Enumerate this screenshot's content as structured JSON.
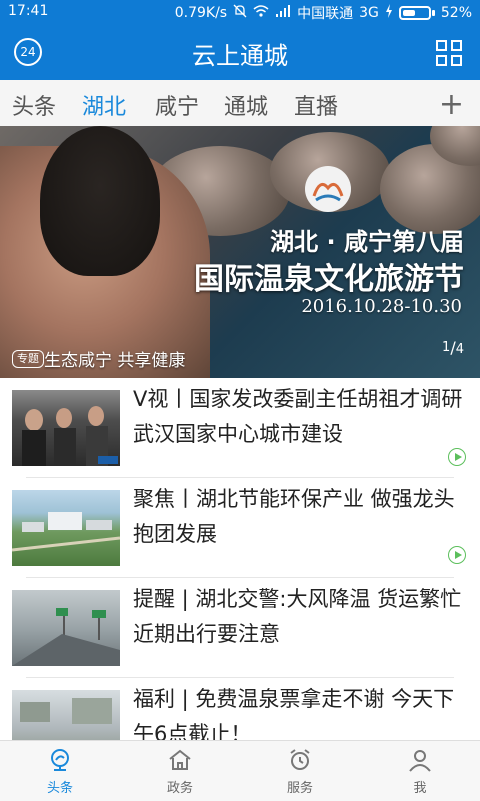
{
  "status_bar": {
    "time": "17:41",
    "speed": "0.79K/s",
    "carrier": "中国联通",
    "network": "3G",
    "battery_percent": "52%",
    "battery_level": 0.52
  },
  "header": {
    "title": "云上通城",
    "badge_24": "24"
  },
  "tabs": [
    {
      "label": "头条",
      "active": false
    },
    {
      "label": "湖北",
      "active": true
    },
    {
      "label": "咸宁",
      "active": false
    },
    {
      "label": "通城",
      "active": false
    },
    {
      "label": "直播",
      "active": false
    }
  ],
  "tabs_add": "+",
  "banner": {
    "line1": "湖北 · 咸宁第八届",
    "line2": "国际温泉文化旅游节",
    "date": "2016.10.28-10.30",
    "tag": "专题",
    "caption": "生态咸宁 共享健康",
    "page_current": "1",
    "page_total": "4"
  },
  "news": [
    {
      "title": "V视丨国家发改委副主任胡祖才调研武汉国家中心城市建设",
      "has_video": true
    },
    {
      "title": "聚焦丨湖北节能环保产业 做强龙头 抱团发展",
      "has_video": true
    },
    {
      "title": "提醒 | 湖北交警:大风降温 货运繁忙 近期出行要注意",
      "has_video": false
    },
    {
      "title": "福利 | 免费温泉票拿走不谢 今天下午6点截止！",
      "has_video": false
    }
  ],
  "bottom_nav": [
    {
      "label": "头条",
      "active": true
    },
    {
      "label": "政务",
      "active": false
    },
    {
      "label": "服务",
      "active": false
    },
    {
      "label": "我",
      "active": false
    }
  ],
  "colors": {
    "brand_blue": "#0f7bd4",
    "active_tab": "#1a89db",
    "video_icon_green": "#5cbf5c"
  }
}
